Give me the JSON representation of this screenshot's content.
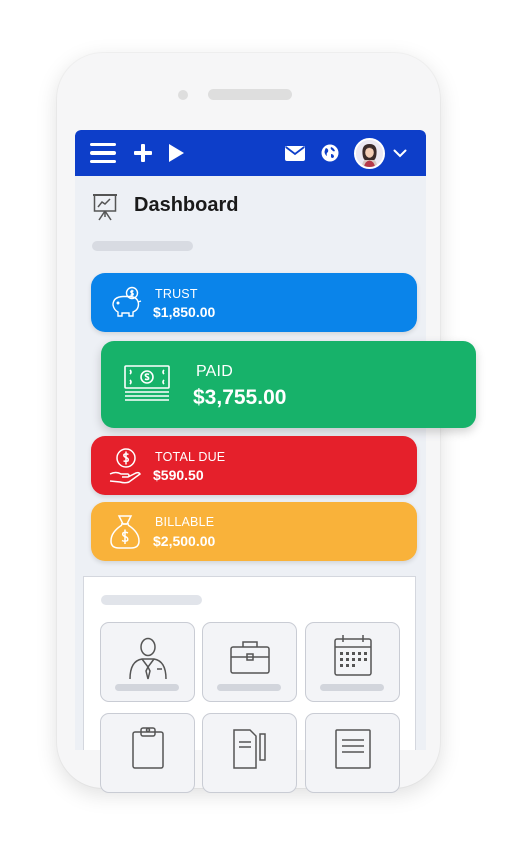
{
  "colors": {
    "appbar": "#0d3ec9",
    "trust": "#0a84ea",
    "paid": "#17b26a",
    "total_due": "#e5202b",
    "billable": "#f9b23a"
  },
  "header": {
    "icons": [
      "menu-icon",
      "plus-icon",
      "play-icon",
      "mail-icon",
      "globe-icon",
      "avatar",
      "chevron-down-icon"
    ]
  },
  "page": {
    "title": "Dashboard",
    "icon": "presentation-chart-icon"
  },
  "cards": {
    "trust": {
      "label": "TRUST",
      "value": "$1,850.00",
      "icon": "piggy-bank-icon"
    },
    "paid": {
      "label": "PAID",
      "value": "$3,755.00",
      "icon": "cash-icon"
    },
    "total_due": {
      "label": "TOTAL DUE",
      "value": "$590.50",
      "icon": "hand-coin-icon"
    },
    "billable": {
      "label": "BILLABLE",
      "value": "$2,500.00",
      "icon": "money-bag-icon"
    }
  },
  "shortcut_tiles": [
    {
      "icon": "user-icon"
    },
    {
      "icon": "briefcase-icon"
    },
    {
      "icon": "calendar-icon"
    },
    {
      "icon": "clipboard-icon"
    },
    {
      "icon": "documents-icon"
    },
    {
      "icon": "note-icon"
    }
  ]
}
